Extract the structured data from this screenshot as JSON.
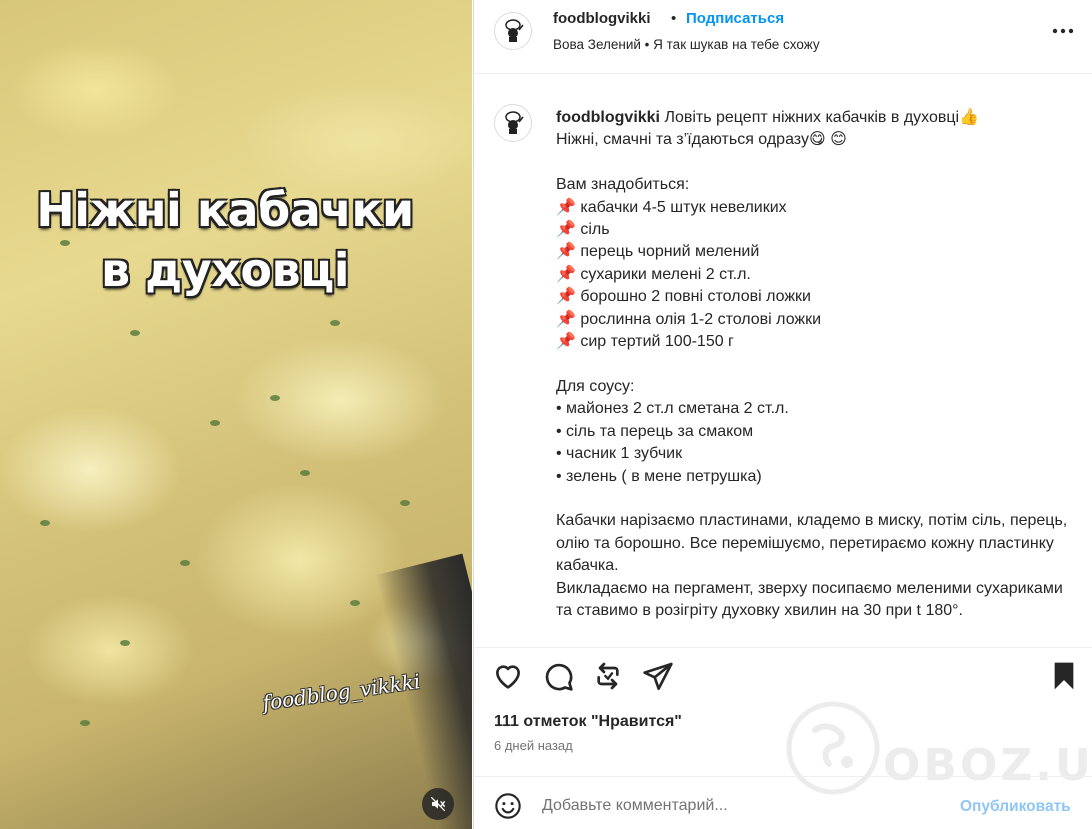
{
  "media": {
    "overlay_title_line1": "Ніжні кабачки",
    "overlay_title_line2": "в духовці",
    "watermark": "foodblog_vikkki",
    "mute_icon": "volume-muted-icon"
  },
  "header": {
    "username": "foodblogvikki",
    "separator": "•",
    "follow_label": "Подписаться",
    "audio_text": "Вова Зелений • Я так шукав на тебе схожу",
    "more_icon": "more-options-icon"
  },
  "caption": {
    "username": "foodblogvikki",
    "text": " Ловіть рецепт ніжних кабачків в духовці👍\nНіжні, смачні та з’їдаються одразу😋 😊\n\nВам знадобиться:\n📌 кабачки 4-5 штук невеликих\n📌 сіль\n📌 перець чорний мелений\n📌 сухарики мелені 2 ст.л.\n📌 борошно 2 повні столові ложки\n📌 рослинна олія 1-2 столові ложки\n📌 сир тертий 100-150 г\n\nДля соусу:\n• майонез 2 ст.л сметана 2 ст.л.\n• сіль та перець за смаком\n• часник 1 зубчик\n• зелень ( в мене петрушка)\n\nКабачки нарізаємо пластинами, кладемо в миску, потім сіль, перець, олію та борошно. Все перемішуємо, перетираємо кожну пластинку кабачка.\nВикладаємо на пергамент, зверху посипаємо меленими сухариками та ставимо в розігріту духовку хвилин на 30 при t 180°."
  },
  "actions": {
    "like_icon": "heart-icon",
    "comment_icon": "comment-icon",
    "repost_icon": "repost-icon",
    "share_icon": "share-icon",
    "save_icon": "bookmark-icon"
  },
  "likes": "111 отметок \"Нравится\"",
  "time": "6 дней назад",
  "comment": {
    "placeholder": "Добавьте комментарий...",
    "publish_label": "Опубликовать",
    "emoji_icon": "emoji-icon"
  },
  "site_watermark": "OBOZ.UA",
  "colors": {
    "accent": "#0095f6",
    "publish_disabled": "#8fc6f5",
    "text": "#262626",
    "muted": "#737373"
  }
}
